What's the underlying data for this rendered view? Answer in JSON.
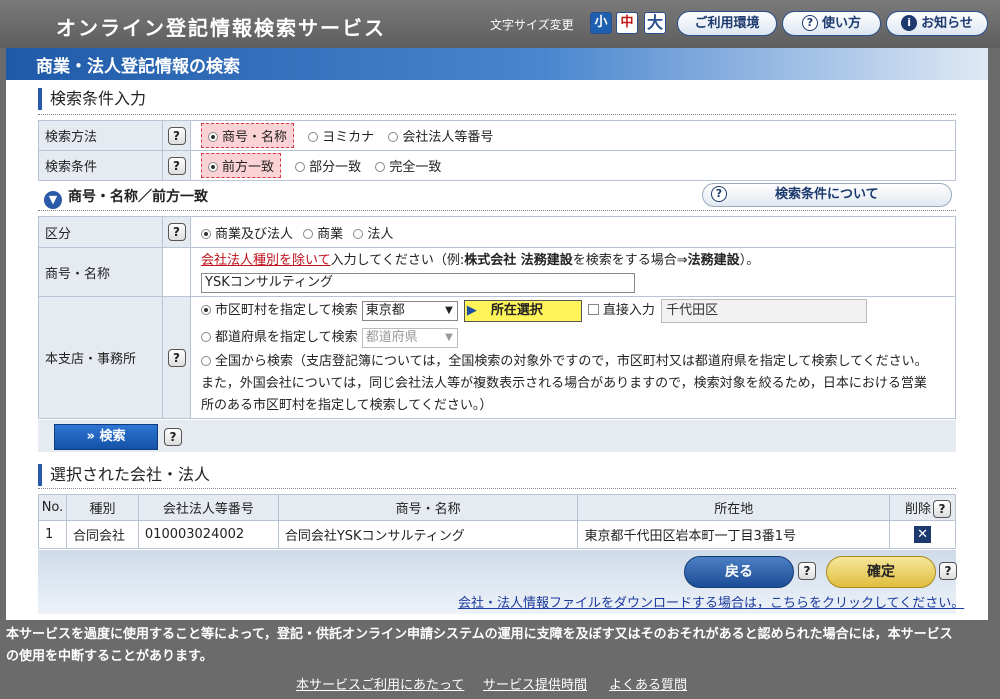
{
  "header": {
    "title": "オンライン登記情報検索サービス",
    "font_size_label": "文字サイズ変更",
    "font_sizes": [
      "小",
      "中",
      "大"
    ],
    "env_button": "ご利用環境",
    "help_button": "使い方",
    "news_button": "お知らせ"
  },
  "page": {
    "title": "商業・法人登記情報の検索"
  },
  "search_conditions": {
    "section_title": "検索条件入力",
    "method_label": "検索方法",
    "method_options": [
      "商号・名称",
      "ヨミカナ",
      "会社法人等番号"
    ],
    "method_selected": "商号・名称",
    "condition_label": "検索条件",
    "condition_options": [
      "前方一致",
      "部分一致",
      "完全一致"
    ],
    "condition_selected": "前方一致",
    "sub_heading": "商号・名称／前方一致",
    "about_button": "検索条件について",
    "q": "?"
  },
  "form": {
    "category_label": "区分",
    "category_options": [
      "商業及び法人",
      "商業",
      "法人"
    ],
    "category_selected": "商業及び法人",
    "name_label": "商号・名称",
    "name_instruction_link": "会社法人種別を除いて",
    "name_instruction_1": "入力してください（例:",
    "name_instruction_ex1": "株式会社 法務建設",
    "name_instruction_2": "を検索をする場合⇒",
    "name_instruction_ex2": "法務建設",
    "name_instruction_3": "）。",
    "name_value": "YSKコンサルティング",
    "office_label": "本支店・事務所",
    "office_opt_city": "市区町村を指定して検索",
    "office_city_pref": "東京都",
    "office_area_button": "所在選択",
    "office_direct_label": "直接入力",
    "office_direct_value": "千代田区",
    "office_opt_pref": "都道府県を指定して検索",
    "office_pref_placeholder": "都道府県",
    "office_opt_all": "全国から検索",
    "office_note_1": "（支店登記簿については，全国検索の対象外ですので，市区町村又は都道府県を指定して検索してください。",
    "office_note_2": "また，外国会社については，同じ会社法人等が複数表示される場合がありますので，検索対象を絞るため，日本における営業",
    "office_note_3": "所のある市区町村を指定して検索してください。）",
    "search_button": "» 検索"
  },
  "selected": {
    "section_title": "選択された会社・法人",
    "columns": [
      "No.",
      "種別",
      "会社法人等番号",
      "商号・名称",
      "所在地",
      "削除"
    ],
    "rows": [
      {
        "no": "1",
        "type": "合同会社",
        "number": "010003024002",
        "name": "合同会社YSKコンサルティング",
        "address": "東京都千代田区岩本町一丁目3番1号",
        "delete": "✕"
      }
    ]
  },
  "actions": {
    "back": "戻る",
    "confirm": "確定",
    "download_link": "会社・法人情報ファイルをダウンロードする場合は，こちらをクリックしてください。"
  },
  "footer": {
    "notice_1": "本サービスを過度に使用すること等によって，登記・供託オンライン申請システムの運用に支障を及ぼす又はそのおそれがあると認められた場合には，本サービス",
    "notice_2": "の使用を中断することがあります。",
    "links": [
      "本サービスご利用にあたって",
      "サービス提供時間",
      "よくある質問"
    ]
  }
}
